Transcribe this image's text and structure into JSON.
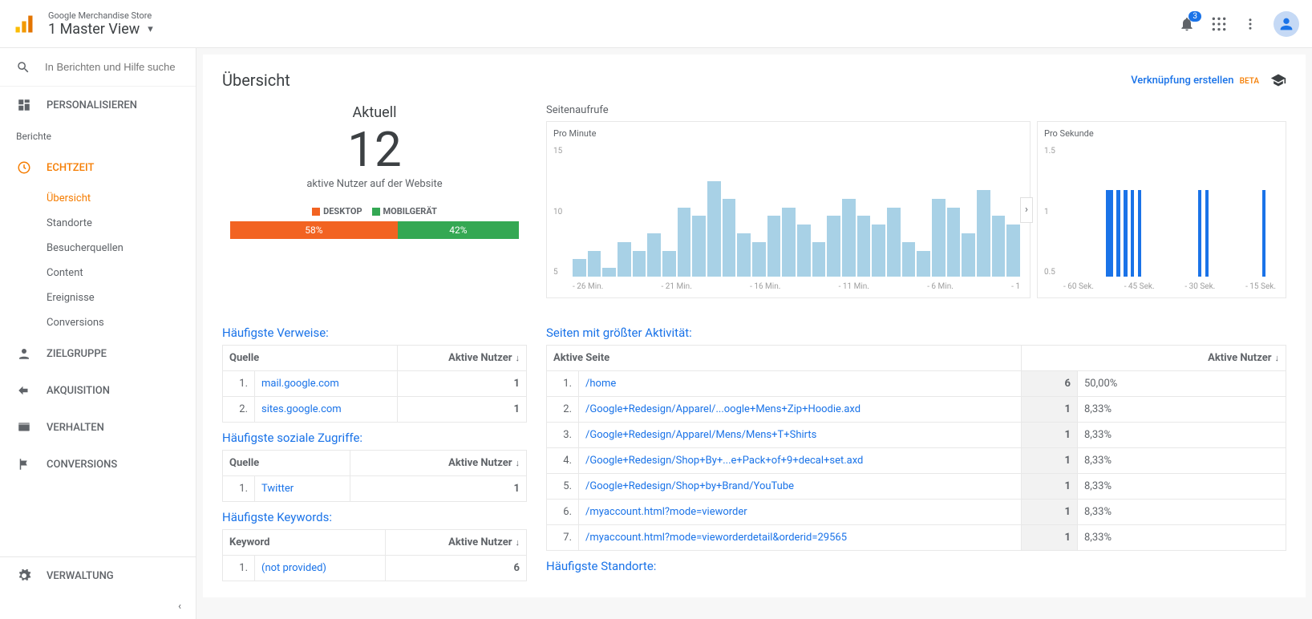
{
  "header": {
    "account_name": "Google Merchandise Store",
    "view_name": "1 Master View",
    "notif_count": "3"
  },
  "sidebar": {
    "search_placeholder": "In Berichten und Hilfe suche",
    "personalize": "PERSONALISIEREN",
    "reports_label": "Berichte",
    "realtime": "ECHTZEIT",
    "realtime_items": [
      "Übersicht",
      "Standorte",
      "Besucherquellen",
      "Content",
      "Ereignisse",
      "Conversions"
    ],
    "audience": "ZIELGRUPPE",
    "acquisition": "AKQUISITION",
    "behavior": "VERHALTEN",
    "conversions": "CONVERSIONS",
    "admin": "VERWALTUNG"
  },
  "page": {
    "title": "Übersicht",
    "create_link": "Verknüpfung erstellen",
    "beta": "BETA"
  },
  "current": {
    "label": "Aktuell",
    "number": "12",
    "sub": "aktive Nutzer auf der Website",
    "desktop_label": "DESKTOP",
    "mobile_label": "MOBILGERÄT",
    "desktop_pct": "58%",
    "mobile_pct": "42%",
    "desktop_color": "#f26322",
    "mobile_color": "#34a853"
  },
  "charts": {
    "heading": "Seitenaufrufe",
    "minute_label": "Pro Minute",
    "second_label": "Pro Sekunde"
  },
  "chart_data": [
    {
      "type": "bar",
      "title": "Seitenaufrufe Pro Minute",
      "ylabel": "Seitenaufrufe",
      "ylim": [
        0,
        15
      ],
      "x_ticks": [
        "- 26 Min.",
        "- 21 Min.",
        "- 16 Min.",
        "- 11 Min.",
        "- 6 Min.",
        "- 1"
      ],
      "y_ticks": [
        "15",
        "10",
        "5"
      ],
      "values": [
        2,
        3,
        1,
        4,
        3,
        5,
        3,
        8,
        7,
        11,
        9,
        5,
        4,
        7,
        8,
        6,
        4,
        7,
        9,
        7,
        6,
        8,
        4,
        3,
        9,
        8,
        5,
        10,
        7,
        6
      ]
    },
    {
      "type": "bar",
      "title": "Seitenaufrufe Pro Sekunde",
      "ylabel": "Seitenaufrufe",
      "ylim": [
        0,
        1.5
      ],
      "x_ticks": [
        "- 60 Sek.",
        "- 45 Sek.",
        "- 30 Sek.",
        "- 15 Sek."
      ],
      "y_ticks": [
        "1.5",
        "1",
        "0.5"
      ],
      "series": [
        {
          "x": 12,
          "v": 1
        },
        {
          "x": 13,
          "v": 1
        },
        {
          "x": 15,
          "v": 1
        },
        {
          "x": 17,
          "v": 1
        },
        {
          "x": 19,
          "v": 1
        },
        {
          "x": 21,
          "v": 1
        },
        {
          "x": 38,
          "v": 1
        },
        {
          "x": 40,
          "v": 1
        },
        {
          "x": 56,
          "v": 1
        }
      ]
    }
  ],
  "referrals": {
    "title": "Häufigste Verweise:",
    "col_source": "Quelle",
    "col_users": "Aktive Nutzer",
    "rows": [
      {
        "idx": "1.",
        "source": "mail.google.com",
        "users": "1"
      },
      {
        "idx": "2.",
        "source": "sites.google.com",
        "users": "1"
      }
    ]
  },
  "social": {
    "title": "Häufigste soziale Zugriffe:",
    "col_source": "Quelle",
    "col_users": "Aktive Nutzer",
    "rows": [
      {
        "idx": "1.",
        "source": "Twitter",
        "users": "1"
      }
    ]
  },
  "keywords": {
    "title": "Häufigste Keywords:",
    "col_k": "Keyword",
    "col_users": "Aktive Nutzer",
    "rows": [
      {
        "idx": "1.",
        "k": "(not provided)",
        "users": "6"
      }
    ]
  },
  "pages": {
    "title": "Seiten mit größter Aktivität:",
    "col_page": "Aktive Seite",
    "col_users": "Aktive Nutzer",
    "rows": [
      {
        "idx": "1.",
        "page": "/home",
        "users": "6",
        "pct": "50,00%"
      },
      {
        "idx": "2.",
        "page": "/Google+Redesign/Apparel/...oogle+Mens+Zip+Hoodie.axd",
        "users": "1",
        "pct": "8,33%"
      },
      {
        "idx": "3.",
        "page": "/Google+Redesign/Apparel/Mens/Mens+T+Shirts",
        "users": "1",
        "pct": "8,33%"
      },
      {
        "idx": "4.",
        "page": "/Google+Redesign/Shop+By+...e+Pack+of+9+decal+set.axd",
        "users": "1",
        "pct": "8,33%"
      },
      {
        "idx": "5.",
        "page": "/Google+Redesign/Shop+by+Brand/YouTube",
        "users": "1",
        "pct": "8,33%"
      },
      {
        "idx": "6.",
        "page": "/myaccount.html?mode=vieworder",
        "users": "1",
        "pct": "8,33%"
      },
      {
        "idx": "7.",
        "page": "/myaccount.html?mode=vieworderdetail&orderid=29565",
        "users": "1",
        "pct": "8,33%"
      }
    ]
  },
  "locations": {
    "title": "Häufigste Standorte:"
  }
}
